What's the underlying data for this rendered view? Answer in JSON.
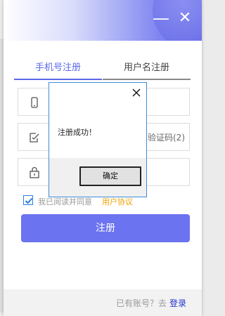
{
  "window": {
    "minimize_glyph": "—",
    "close_glyph": "✕"
  },
  "tabs": {
    "phone": "手机号注册",
    "username": "用户名注册"
  },
  "fields": {
    "phone_icon": "phone-icon",
    "code_icon": "edit-check-icon",
    "password_icon": "lock-icon",
    "get_code_label": "验证码(2)"
  },
  "agreement": {
    "text": "我已阅读并同意",
    "link": "用户协议",
    "checked": true
  },
  "submit_label": "注册",
  "footer": {
    "prompt": "已有账号？去",
    "login": "登录"
  },
  "dialog": {
    "message": "注册成功！",
    "ok_label": "确定"
  },
  "colors": {
    "accent": "#6b73f0",
    "link": "#f0a000",
    "login_link": "#2233cc"
  }
}
